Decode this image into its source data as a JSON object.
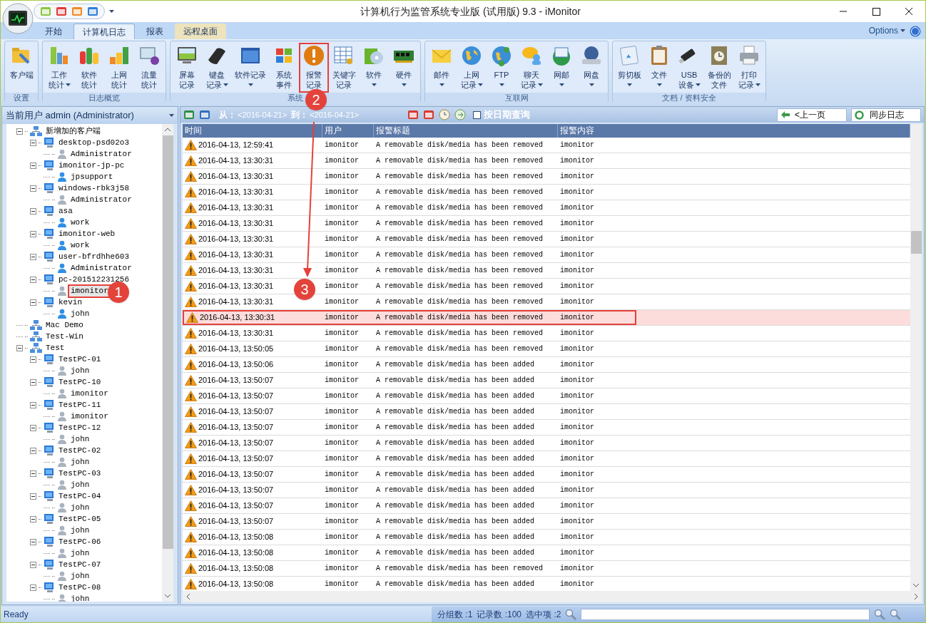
{
  "window": {
    "title": "计算机行为监管系统专业版 (试用版) 9.3 - iMonitor"
  },
  "tabs": [
    {
      "label": "开始",
      "selected": false,
      "kind": "normal"
    },
    {
      "label": "计算机日志",
      "selected": true,
      "kind": "normal"
    },
    {
      "label": "报表",
      "selected": false,
      "kind": "normal"
    },
    {
      "label": "远程桌面",
      "selected": false,
      "kind": "contextual"
    }
  ],
  "options": {
    "label": "Options"
  },
  "ribbon_groups": [
    {
      "title": "设置",
      "buttons": [
        {
          "lines": [
            "客户端"
          ],
          "dropdown": false,
          "outlined": false
        }
      ]
    },
    {
      "title": "日志概览",
      "buttons": [
        {
          "lines": [
            "工作",
            "统计"
          ],
          "dropdown": true,
          "outlined": false
        },
        {
          "lines": [
            "软件",
            "统计"
          ],
          "dropdown": false,
          "outlined": false
        },
        {
          "lines": [
            "上网",
            "统计"
          ],
          "dropdown": false,
          "outlined": false
        },
        {
          "lines": [
            "流量",
            "统计"
          ],
          "dropdown": false,
          "outlined": false
        }
      ]
    },
    {
      "title": "系统",
      "buttons": [
        {
          "lines": [
            "屏幕",
            "记录"
          ],
          "dropdown": false,
          "outlined": false
        },
        {
          "lines": [
            "键盘",
            "记录"
          ],
          "dropdown": true,
          "outlined": false
        },
        {
          "lines": [
            "软件记录"
          ],
          "dropdown": true,
          "outlined": false
        },
        {
          "lines": [
            "系统",
            "事件"
          ],
          "dropdown": false,
          "outlined": false
        },
        {
          "lines": [
            "报警",
            "记录"
          ],
          "dropdown": false,
          "outlined": true
        },
        {
          "lines": [
            "关键字",
            "记录"
          ],
          "dropdown": false,
          "outlined": false
        },
        {
          "lines": [
            "软件"
          ],
          "dropdown": true,
          "outlined": false
        },
        {
          "lines": [
            "硬件"
          ],
          "dropdown": true,
          "outlined": false
        }
      ]
    },
    {
      "title": "互联网",
      "buttons": [
        {
          "lines": [
            "邮件"
          ],
          "dropdown": true,
          "outlined": false
        },
        {
          "lines": [
            "上网",
            "记录"
          ],
          "dropdown": true,
          "outlined": false
        },
        {
          "lines": [
            "FTP"
          ],
          "dropdown": true,
          "outlined": false
        },
        {
          "lines": [
            "聊天",
            "记录"
          ],
          "dropdown": true,
          "outlined": false
        },
        {
          "lines": [
            "网邮"
          ],
          "dropdown": true,
          "outlined": false
        },
        {
          "lines": [
            "网盘"
          ],
          "dropdown": true,
          "outlined": false
        }
      ]
    },
    {
      "title": "文档 / 资料安全",
      "buttons": [
        {
          "lines": [
            "剪切板"
          ],
          "dropdown": true,
          "outlined": false
        },
        {
          "lines": [
            "文件"
          ],
          "dropdown": true,
          "outlined": false
        },
        {
          "lines": [
            "USB",
            "设备"
          ],
          "dropdown": true,
          "outlined": false
        },
        {
          "lines": [
            "备份的",
            "文件"
          ],
          "dropdown": false,
          "outlined": false
        },
        {
          "lines": [
            "打印",
            "记录"
          ],
          "dropdown": true,
          "outlined": false
        }
      ]
    }
  ],
  "user_selector": {
    "label": "当前用户 admin (Administrator)"
  },
  "tree": [
    {
      "label": "新增加的客户端",
      "kind": "group",
      "expanded": true,
      "selected": false,
      "outlined": false,
      "children": [
        {
          "label": "desktop-psd02o3",
          "kind": "computer",
          "expanded": true,
          "selected": false,
          "outlined": false,
          "children": [
            {
              "label": "Administrator",
              "kind": "user",
              "online": false,
              "selected": false,
              "outlined": false
            }
          ]
        },
        {
          "label": "imonitor-jp-pc",
          "kind": "computer",
          "expanded": true,
          "selected": false,
          "outlined": false,
          "children": [
            {
              "label": "jpsupport",
              "kind": "user",
              "online": true,
              "selected": false,
              "outlined": false
            }
          ]
        },
        {
          "label": "windows-rbk3j58",
          "kind": "computer",
          "expanded": true,
          "selected": false,
          "outlined": false,
          "children": [
            {
              "label": "Administrator",
              "kind": "user",
              "online": false,
              "selected": false,
              "outlined": false
            }
          ]
        },
        {
          "label": "asa",
          "kind": "computer",
          "expanded": true,
          "selected": false,
          "outlined": false,
          "children": [
            {
              "label": "work",
              "kind": "user",
              "online": true,
              "selected": false,
              "outlined": false
            }
          ]
        },
        {
          "label": "imonitor-web",
          "kind": "computer",
          "expanded": true,
          "selected": false,
          "outlined": false,
          "children": [
            {
              "label": "work",
              "kind": "user",
              "online": true,
              "selected": false,
              "outlined": false
            }
          ]
        },
        {
          "label": "user-bfrdhhe603",
          "kind": "computer",
          "expanded": true,
          "selected": false,
          "outlined": false,
          "children": [
            {
              "label": "Administrator",
              "kind": "user",
              "online": true,
              "selected": false,
              "outlined": false
            }
          ]
        },
        {
          "label": "pc-201512231256",
          "kind": "computer",
          "expanded": true,
          "selected": false,
          "outlined": false,
          "children": [
            {
              "label": "imonitor",
              "kind": "user",
              "online": false,
              "selected": true,
              "outlined": true
            }
          ]
        },
        {
          "label": "kevin",
          "kind": "computer",
          "expanded": true,
          "selected": false,
          "outlined": false,
          "children": [
            {
              "label": "john",
              "kind": "user",
              "online": true,
              "selected": false,
              "outlined": false
            }
          ]
        }
      ]
    },
    {
      "label": "Mac Demo",
      "kind": "group",
      "expanded": false,
      "selected": false,
      "outlined": false
    },
    {
      "label": "Test-Win",
      "kind": "group",
      "expanded": false,
      "selected": false,
      "outlined": false
    },
    {
      "label": "Test",
      "kind": "group",
      "expanded": true,
      "selected": false,
      "outlined": false,
      "children": [
        {
          "label": "TestPC-01",
          "kind": "computer",
          "expanded": true,
          "selected": false,
          "outlined": false,
          "children": [
            {
              "label": "john",
              "kind": "user",
              "online": false,
              "selected": false,
              "outlined": false
            }
          ]
        },
        {
          "label": "TestPC-10",
          "kind": "computer",
          "expanded": true,
          "selected": false,
          "outlined": false,
          "children": [
            {
              "label": "imonitor",
              "kind": "user",
              "online": false,
              "selected": false,
              "outlined": false
            }
          ]
        },
        {
          "label": "TestPC-11",
          "kind": "computer",
          "expanded": true,
          "selected": false,
          "outlined": false,
          "children": [
            {
              "label": "imonitor",
              "kind": "user",
              "online": false,
              "selected": false,
              "outlined": false
            }
          ]
        },
        {
          "label": "TestPC-12",
          "kind": "computer",
          "expanded": true,
          "selected": false,
          "outlined": false,
          "children": [
            {
              "label": "john",
              "kind": "user",
              "online": false,
              "selected": false,
              "outlined": false
            }
          ]
        },
        {
          "label": "TestPC-02",
          "kind": "computer",
          "expanded": true,
          "selected": false,
          "outlined": false,
          "children": [
            {
              "label": "john",
              "kind": "user",
              "online": false,
              "selected": false,
              "outlined": false
            }
          ]
        },
        {
          "label": "TestPC-03",
          "kind": "computer",
          "expanded": true,
          "selected": false,
          "outlined": false,
          "children": [
            {
              "label": "john",
              "kind": "user",
              "online": false,
              "selected": false,
              "outlined": false
            }
          ]
        },
        {
          "label": "TestPC-04",
          "kind": "computer",
          "expanded": true,
          "selected": false,
          "outlined": false,
          "children": [
            {
              "label": "john",
              "kind": "user",
              "online": false,
              "selected": false,
              "outlined": false
            }
          ]
        },
        {
          "label": "TestPC-05",
          "kind": "computer",
          "expanded": true,
          "selected": false,
          "outlined": false,
          "children": [
            {
              "label": "john",
              "kind": "user",
              "online": false,
              "selected": false,
              "outlined": false
            }
          ]
        },
        {
          "label": "TestPC-06",
          "kind": "computer",
          "expanded": true,
          "selected": false,
          "outlined": false,
          "children": [
            {
              "label": "john",
              "kind": "user",
              "online": false,
              "selected": false,
              "outlined": false
            }
          ]
        },
        {
          "label": "TestPC-07",
          "kind": "computer",
          "expanded": true,
          "selected": false,
          "outlined": false,
          "children": [
            {
              "label": "john",
              "kind": "user",
              "online": false,
              "selected": false,
              "outlined": false
            }
          ]
        },
        {
          "label": "TestPC-08",
          "kind": "computer",
          "expanded": true,
          "selected": false,
          "outlined": false,
          "children": [
            {
              "label": "john",
              "kind": "user",
              "online": false,
              "selected": false,
              "outlined": false
            }
          ]
        }
      ]
    }
  ],
  "toolbar": {
    "from_label": "从：",
    "from_date": "<2016-04-21>",
    "to_label": "到：",
    "to_date": "<2016-04-21>",
    "date_query": {
      "label": "按日期查询",
      "checked": false
    },
    "prev_button": "<上一页",
    "sync_button": "同步日志"
  },
  "table": {
    "columns": [
      "时间",
      "用户",
      "报警标题",
      "报警内容"
    ],
    "rows": [
      {
        "time": "2016-04-13, 12:59:41",
        "user": "imonitor",
        "title": "A removable disk/media has been removed",
        "content": "imonitor",
        "selected": false,
        "outlined": false
      },
      {
        "time": "2016-04-13, 13:30:31",
        "user": "imonitor",
        "title": "A removable disk/media has been removed",
        "content": "imonitor",
        "selected": false,
        "outlined": false
      },
      {
        "time": "2016-04-13, 13:30:31",
        "user": "imonitor",
        "title": "A removable disk/media has been removed",
        "content": "imonitor",
        "selected": false,
        "outlined": false
      },
      {
        "time": "2016-04-13, 13:30:31",
        "user": "imonitor",
        "title": "A removable disk/media has been removed",
        "content": "imonitor",
        "selected": false,
        "outlined": false
      },
      {
        "time": "2016-04-13, 13:30:31",
        "user": "imonitor",
        "title": "A removable disk/media has been removed",
        "content": "imonitor",
        "selected": false,
        "outlined": false
      },
      {
        "time": "2016-04-13, 13:30:31",
        "user": "imonitor",
        "title": "A removable disk/media has been removed",
        "content": "imonitor",
        "selected": false,
        "outlined": false
      },
      {
        "time": "2016-04-13, 13:30:31",
        "user": "imonitor",
        "title": "A removable disk/media has been removed",
        "content": "imonitor",
        "selected": false,
        "outlined": false
      },
      {
        "time": "2016-04-13, 13:30:31",
        "user": "imonitor",
        "title": "A removable disk/media has been removed",
        "content": "imonitor",
        "selected": false,
        "outlined": false
      },
      {
        "time": "2016-04-13, 13:30:31",
        "user": "imonitor",
        "title": "A removable disk/media has been removed",
        "content": "imonitor",
        "selected": false,
        "outlined": false
      },
      {
        "time": "2016-04-13, 13:30:31",
        "user": "imonitor",
        "title": "A removable disk/media has been removed",
        "content": "imonitor",
        "selected": false,
        "outlined": false
      },
      {
        "time": "2016-04-13, 13:30:31",
        "user": "imonitor",
        "title": "A removable disk/media has been removed",
        "content": "imonitor",
        "selected": false,
        "outlined": false
      },
      {
        "time": "2016-04-13, 13:30:31",
        "user": "imonitor",
        "title": "A removable disk/media has been removed",
        "content": "imonitor",
        "selected": true,
        "outlined": true
      },
      {
        "time": "2016-04-13, 13:30:31",
        "user": "imonitor",
        "title": "A removable disk/media has been removed",
        "content": "imonitor",
        "selected": false,
        "outlined": false
      },
      {
        "time": "2016-04-13, 13:50:05",
        "user": "imonitor",
        "title": "A removable disk/media has been removed",
        "content": "imonitor",
        "selected": false,
        "outlined": false
      },
      {
        "time": "2016-04-13, 13:50:06",
        "user": "imonitor",
        "title": "A removable disk/media has been added",
        "content": "imonitor",
        "selected": false,
        "outlined": false
      },
      {
        "time": "2016-04-13, 13:50:07",
        "user": "imonitor",
        "title": "A removable disk/media has been added",
        "content": "imonitor",
        "selected": false,
        "outlined": false
      },
      {
        "time": "2016-04-13, 13:50:07",
        "user": "imonitor",
        "title": "A removable disk/media has been added",
        "content": "imonitor",
        "selected": false,
        "outlined": false
      },
      {
        "time": "2016-04-13, 13:50:07",
        "user": "imonitor",
        "title": "A removable disk/media has been added",
        "content": "imonitor",
        "selected": false,
        "outlined": false
      },
      {
        "time": "2016-04-13, 13:50:07",
        "user": "imonitor",
        "title": "A removable disk/media has been added",
        "content": "imonitor",
        "selected": false,
        "outlined": false
      },
      {
        "time": "2016-04-13, 13:50:07",
        "user": "imonitor",
        "title": "A removable disk/media has been added",
        "content": "imonitor",
        "selected": false,
        "outlined": false
      },
      {
        "time": "2016-04-13, 13:50:07",
        "user": "imonitor",
        "title": "A removable disk/media has been added",
        "content": "imonitor",
        "selected": false,
        "outlined": false
      },
      {
        "time": "2016-04-13, 13:50:07",
        "user": "imonitor",
        "title": "A removable disk/media has been added",
        "content": "imonitor",
        "selected": false,
        "outlined": false
      },
      {
        "time": "2016-04-13, 13:50:07",
        "user": "imonitor",
        "title": "A removable disk/media has been added",
        "content": "imonitor",
        "selected": false,
        "outlined": false
      },
      {
        "time": "2016-04-13, 13:50:07",
        "user": "imonitor",
        "title": "A removable disk/media has been added",
        "content": "imonitor",
        "selected": false,
        "outlined": false
      },
      {
        "time": "2016-04-13, 13:50:07",
        "user": "imonitor",
        "title": "A removable disk/media has been added",
        "content": "imonitor",
        "selected": false,
        "outlined": false
      },
      {
        "time": "2016-04-13, 13:50:08",
        "user": "imonitor",
        "title": "A removable disk/media has been added",
        "content": "imonitor",
        "selected": false,
        "outlined": false
      },
      {
        "time": "2016-04-13, 13:50:08",
        "user": "imonitor",
        "title": "A removable disk/media has been added",
        "content": "imonitor",
        "selected": false,
        "outlined": false
      },
      {
        "time": "2016-04-13, 13:50:08",
        "user": "imonitor",
        "title": "A removable disk/media has been removed",
        "content": "imonitor",
        "selected": false,
        "outlined": false
      },
      {
        "time": "2016-04-13, 13:50:08",
        "user": "imonitor",
        "title": "A removable disk/media has been added",
        "content": "imonitor",
        "selected": false,
        "outlined": false
      }
    ]
  },
  "status_bar": {
    "ready": "Ready",
    "groups": "分组数 :1",
    "records": "记录数 :100",
    "selected": "选中项 :2"
  },
  "annotations": [
    {
      "label": "1"
    },
    {
      "label": "2"
    },
    {
      "label": "3"
    }
  ]
}
